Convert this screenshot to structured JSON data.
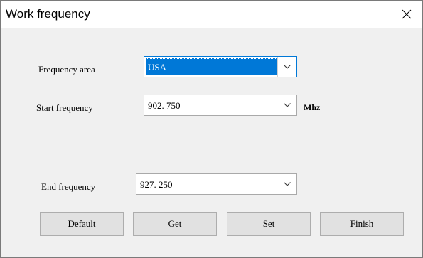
{
  "window": {
    "title": "Work frequency",
    "close_icon": "close-icon"
  },
  "form": {
    "frequency_area": {
      "label": "Frequency area",
      "value": "USA"
    },
    "start_frequency": {
      "label": "Start frequency",
      "value": "902. 750",
      "unit": "Mhz"
    },
    "end_frequency": {
      "label": "End frequency",
      "value": "927. 250"
    }
  },
  "buttons": {
    "default_label": "Default",
    "get_label": "Get",
    "set_label": "Set",
    "finish_label": "Finish"
  },
  "colors": {
    "accent": "#0078d7",
    "button_face": "#e1e1e1",
    "dialog_background": "#f0f0f0"
  }
}
